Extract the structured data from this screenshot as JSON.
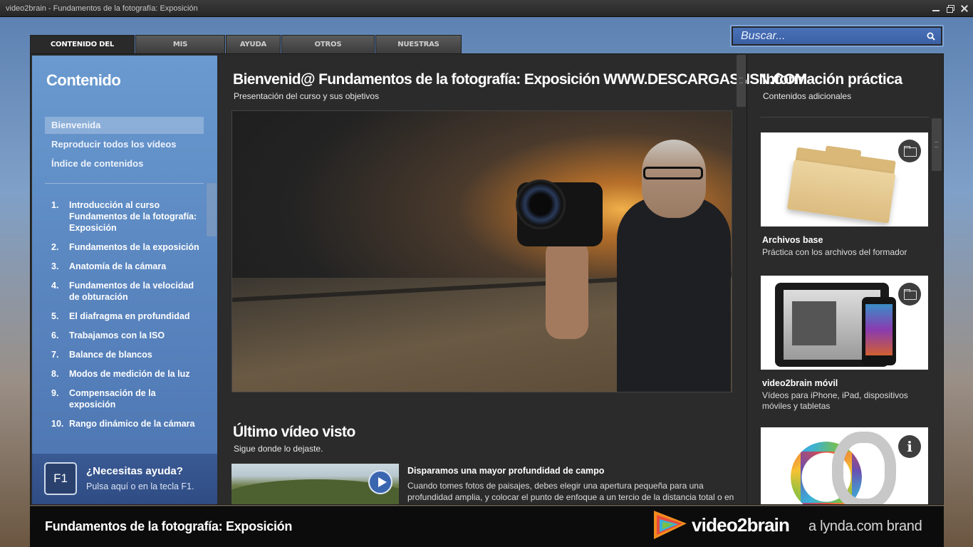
{
  "window": {
    "title": "video2brain - Fundamentos de la fotografía: Exposición"
  },
  "tabs": [
    {
      "label": "CONTENIDO DEL CURSO",
      "active": true
    },
    {
      "label": "MIS MARCADORES",
      "active": false
    },
    {
      "label": "AYUDA",
      "active": false
    },
    {
      "label": "OTROS PRODUCTOS",
      "active": false
    },
    {
      "label": "NUESTRAS WEBS",
      "active": false
    }
  ],
  "search": {
    "placeholder": "Buscar..."
  },
  "sidebar": {
    "title": "Contenido",
    "nav": [
      {
        "label": "Bienvenida",
        "selected": true
      },
      {
        "label": "Reproducir todos los vídeos",
        "selected": false
      },
      {
        "label": "Índice de contenidos",
        "selected": false
      }
    ],
    "chapters": [
      {
        "num": "1.",
        "label": "Introducción al curso Fundamentos de la fotografía: Exposición"
      },
      {
        "num": "2.",
        "label": "Fundamentos de la exposición"
      },
      {
        "num": "3.",
        "label": "Anatomía de la cámara"
      },
      {
        "num": "4.",
        "label": "Fundamentos de la velocidad de obturación"
      },
      {
        "num": "5.",
        "label": "El diafragma en profundidad"
      },
      {
        "num": "6.",
        "label": "Trabajamos con la ISO"
      },
      {
        "num": "7.",
        "label": "Balance de blancos"
      },
      {
        "num": "8.",
        "label": "Modos de medición de la luz"
      },
      {
        "num": "9.",
        "label": "Compensación de la exposición"
      },
      {
        "num": "10.",
        "label": "Rango dinámico de la cámara"
      }
    ],
    "help": {
      "key": "F1",
      "title": "¿Necesitas ayuda?",
      "subtitle": "Pulsa aquí o en la tecla F1."
    }
  },
  "main": {
    "title": "Bienvenid@ Fundamentos de la fotografía: Exposición WWW.DESCARGASNSN.COM",
    "subtitle": "Presentación del curso y sus objetivos",
    "last_video": {
      "heading": "Último vídeo visto",
      "subheading": "Sigue donde lo dejaste.",
      "title": "Disparamos una mayor profundidad de campo",
      "description": "Cuando tomes fotos de paisajes, debes elegir una apertura pequeña para una profundidad amplia, y colocar el punto de enfoque a un tercio de la distancia total o en el sujeto principal."
    }
  },
  "info": {
    "title": "Información práctica",
    "subtitle": "Contenidos adicionales",
    "cards": [
      {
        "title": "Archivos base",
        "description": "Práctica con los archivos del formador",
        "icon": "folder-icon"
      },
      {
        "title": "video2brain móvil",
        "description": "Vídeos para iPhone, iPad, dispositivos móviles y tabletas",
        "icon": "folder-icon"
      },
      {
        "title": "",
        "description": "",
        "icon": "info-icon"
      }
    ],
    "info_glyph": "i"
  },
  "footer": {
    "course_title": "Fundamentos de la fotografía: Exposición",
    "logo_name": "video2brain",
    "brand": "a lynda.com brand"
  },
  "colors": {
    "sidebar_blue": "#5a86c0",
    "accent_blue": "#3a66b0",
    "background_dark": "#2b2b2b"
  }
}
